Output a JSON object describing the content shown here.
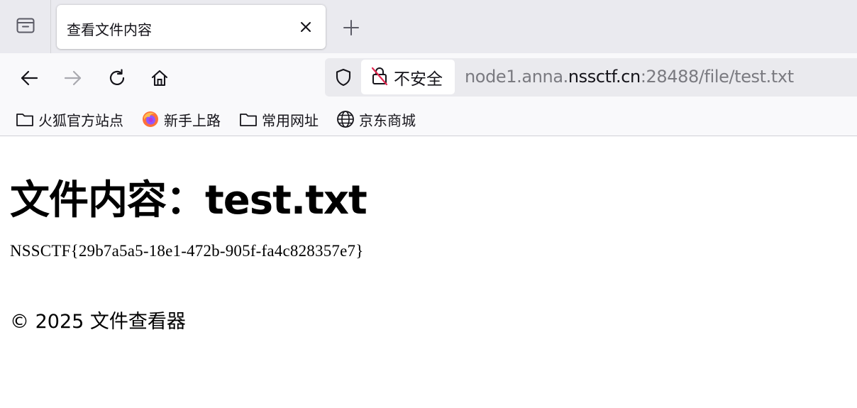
{
  "browser": {
    "tab": {
      "title": "查看文件内容"
    },
    "url_bar": {
      "identity_label": "不安全",
      "url_prefix": "node1.anna.",
      "url_host": "nssctf.cn",
      "url_suffix": ":28488/file/test.txt"
    },
    "bookmarks": [
      {
        "label": "火狐官方站点",
        "icon": "folder-icon"
      },
      {
        "label": "新手上路",
        "icon": "firefox-icon"
      },
      {
        "label": "常用网址",
        "icon": "folder-icon"
      },
      {
        "label": "京东商城",
        "icon": "globe-icon"
      }
    ],
    "colors": {
      "tabstrip_bg": "#eaeaef",
      "toolbar_bg": "#f9f9fb",
      "insecure_slash": "#e22850"
    }
  },
  "page": {
    "heading": "文件内容：test.txt",
    "file_content": "NSSCTF{29b7a5a5-18e1-472b-905f-fa4c828357e7}",
    "footer": "© 2025 文件查看器"
  }
}
